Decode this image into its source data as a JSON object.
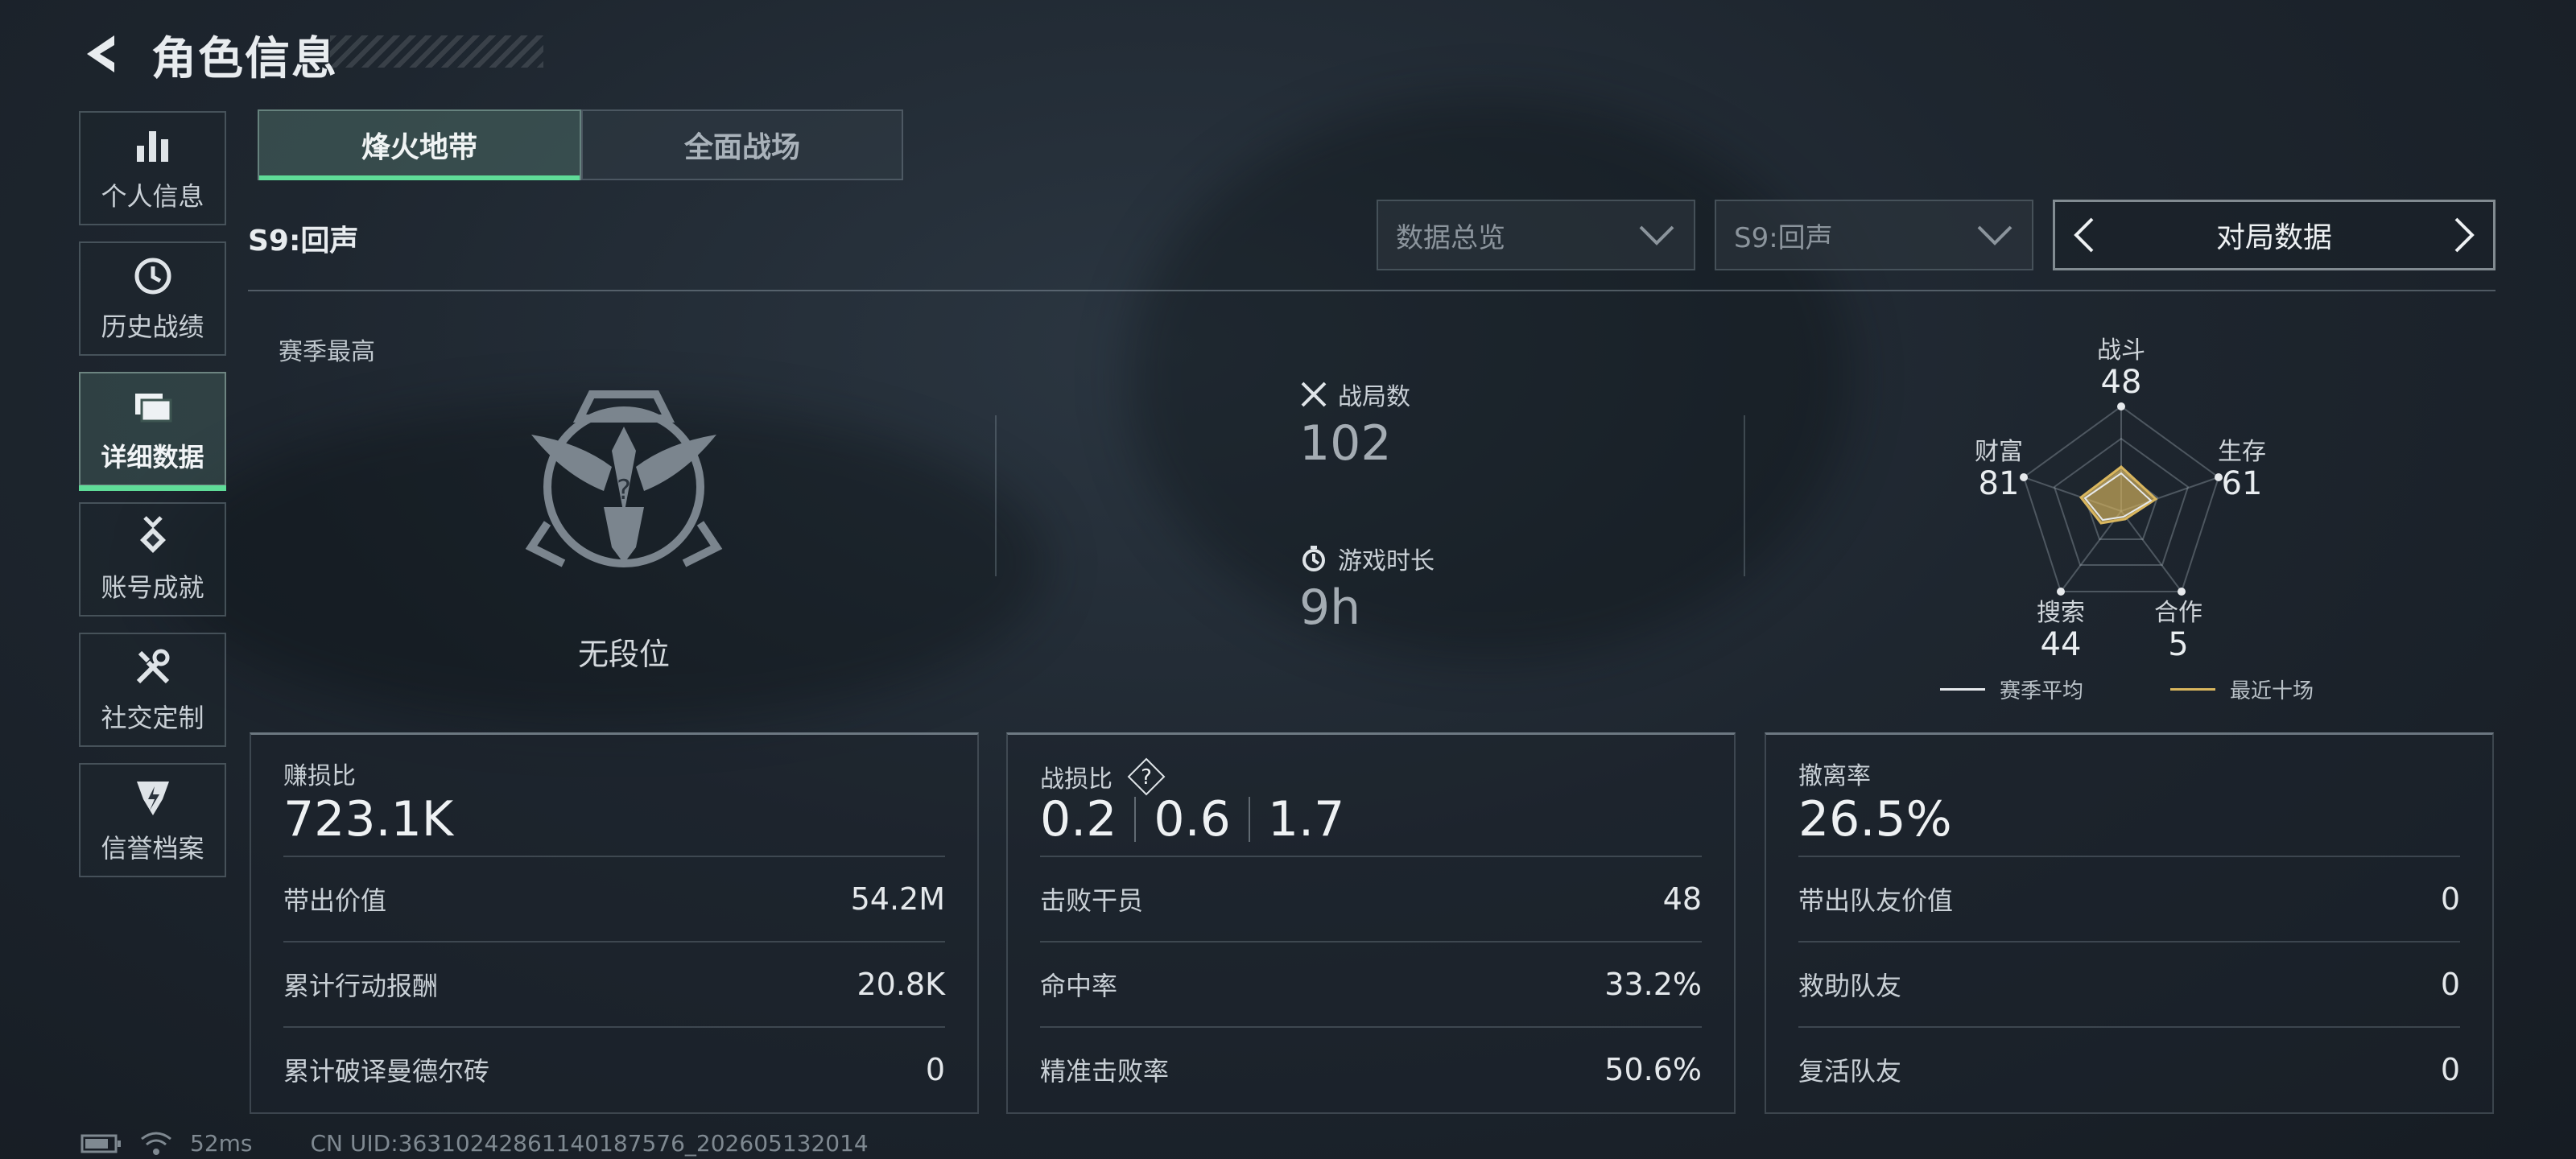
{
  "header": {
    "title": "角色信息"
  },
  "sidebar": {
    "items": [
      {
        "label": "个人信息",
        "icon": "bar-chart-icon"
      },
      {
        "label": "历史战绩",
        "icon": "clock-history-icon"
      },
      {
        "label": "详细数据",
        "icon": "folders-icon",
        "active": true
      },
      {
        "label": "账号成就",
        "icon": "medal-icon"
      },
      {
        "label": "社交定制",
        "icon": "tools-icon"
      },
      {
        "label": "信誉档案",
        "icon": "shield-badge-icon"
      }
    ]
  },
  "tabs": [
    {
      "label": "烽火地带",
      "selected": true
    },
    {
      "label": "全面战场",
      "selected": false
    }
  ],
  "season": {
    "label": "S9:回声"
  },
  "filters": {
    "dropdown1": "数据总览",
    "dropdown2": "S9:回声",
    "nav_label": "对局数据"
  },
  "overview": {
    "season_best_label": "赛季最高",
    "rank_name": "无段位",
    "matches_label": "战局数",
    "matches_value": "102",
    "playtime_label": "游戏时长",
    "playtime_value": "9h"
  },
  "radar": {
    "axes": [
      {
        "label": "战斗",
        "value": "48"
      },
      {
        "label": "生存",
        "value": "61"
      },
      {
        "label": "合作",
        "value": "5"
      },
      {
        "label": "搜索",
        "value": "44"
      },
      {
        "label": "财富",
        "value": "81"
      }
    ],
    "legend": {
      "season_avg": "赛季平均",
      "recent_ten": "最近十场"
    },
    "colors": {
      "season_avg": "#e6e9ec",
      "recent_ten": "#d9b65e"
    }
  },
  "panels": {
    "profit": {
      "title": "赚损比",
      "value": "723.1K",
      "rows": [
        {
          "label": "带出价值",
          "value": "54.2M"
        },
        {
          "label": "累计行动报酬",
          "value": "20.8K"
        },
        {
          "label": "累计破译曼德尔砖",
          "value": "0"
        }
      ]
    },
    "combat": {
      "title": "战损比",
      "help": "?",
      "ratios": [
        "0.2",
        "0.6",
        "1.7"
      ],
      "rows": [
        {
          "label": "击败干员",
          "value": "48"
        },
        {
          "label": "命中率",
          "value": "33.2%"
        },
        {
          "label": "精准击败率",
          "value": "50.6%"
        }
      ]
    },
    "extract": {
      "title": "撤离率",
      "value": "26.5%",
      "rows": [
        {
          "label": "带出队友价值",
          "value": "0"
        },
        {
          "label": "救助队友",
          "value": "0"
        },
        {
          "label": "复活队友",
          "value": "0"
        }
      ]
    }
  },
  "footer": {
    "ping": "52ms",
    "uid": "CN UID:3631024286114018757​6_202605132014"
  },
  "accent_color": "#5fdc98"
}
